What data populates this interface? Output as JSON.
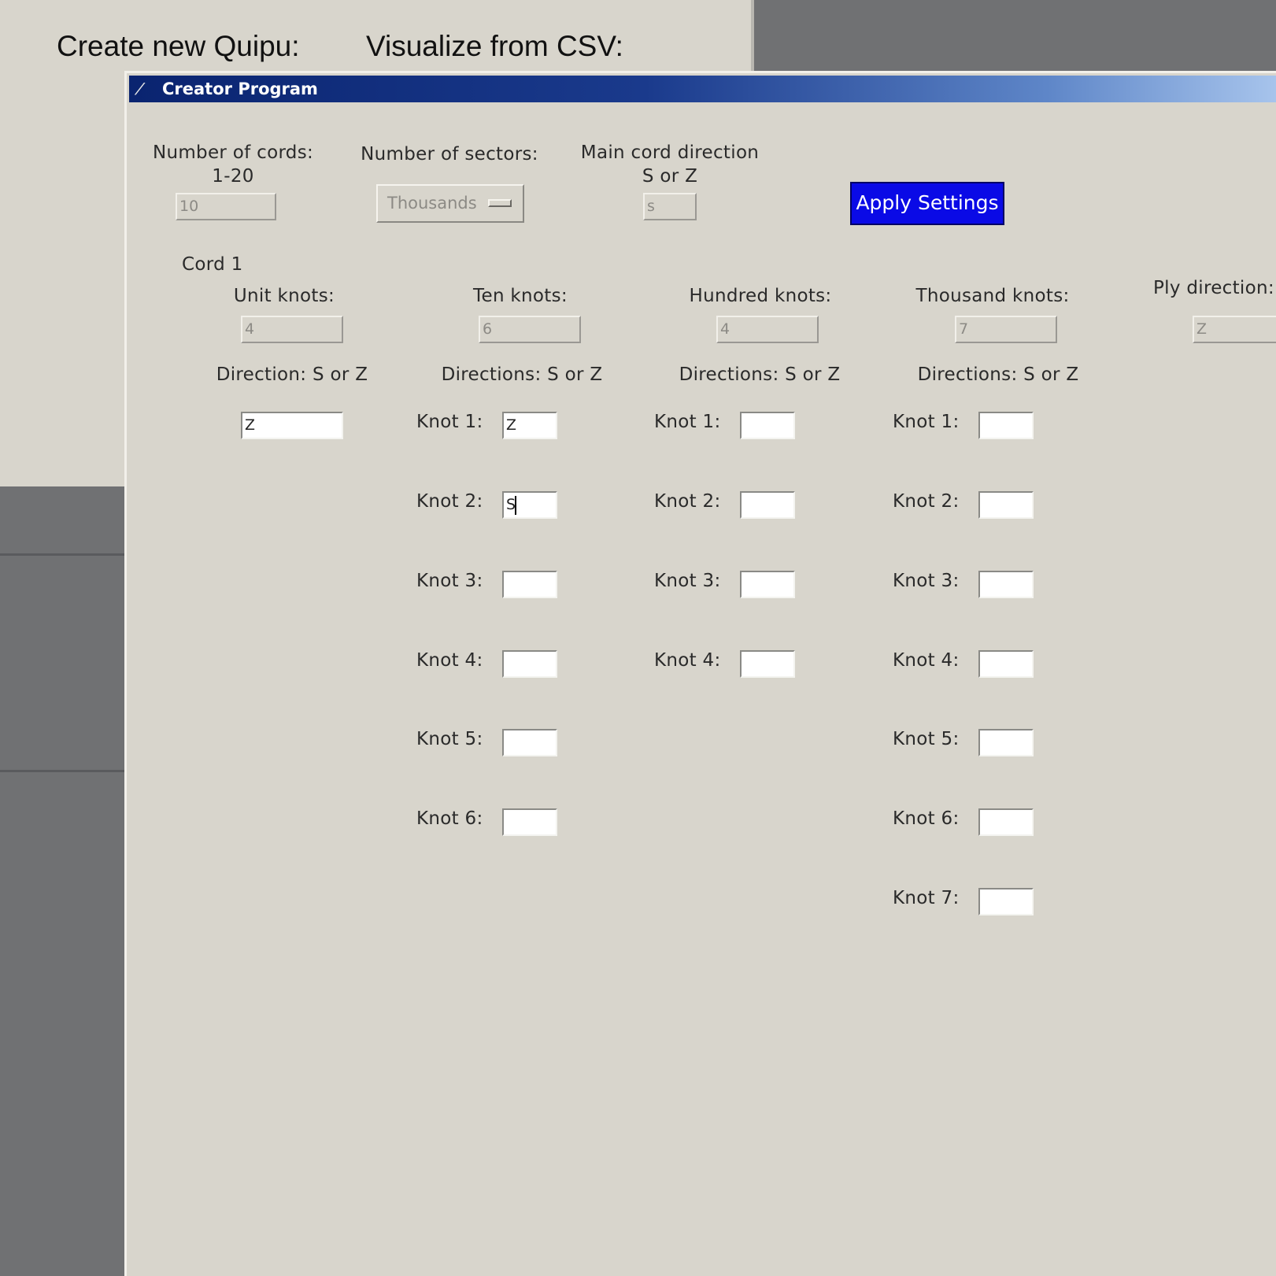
{
  "background_window": {
    "create_heading": "Create new Quipu:",
    "visualize_heading": "Visualize from CSV:"
  },
  "dialog": {
    "title": "Creator Program",
    "settings": {
      "cords_label_line1": "Number of cords:",
      "cords_label_line2": "1-20",
      "cords_value": "10",
      "sectors_label": "Number of sectors:",
      "sectors_selected": "Thousands",
      "direction_label_line1": "Main cord direction",
      "direction_label_line2": "S or Z",
      "direction_value": "s",
      "apply_label": "Apply Settings"
    },
    "cord": {
      "title": "Cord 1",
      "unit_knots_label": "Unit knots:",
      "unit_knots_value": "4",
      "ten_knots_label": "Ten knots:",
      "ten_knots_value": "6",
      "hundred_knots_label": "Hundred knots:",
      "hundred_knots_value": "4",
      "thousand_knots_label": "Thousand knots:",
      "thousand_knots_value": "7",
      "ply_label": "Ply direction:",
      "ply_value": "Z",
      "unit_direction_label": "Direction: S or Z",
      "unit_direction_value": "Z",
      "directions_label": "Directions: S or Z",
      "ten_knots": [
        {
          "label": "Knot 1:",
          "value": "Z"
        },
        {
          "label": "Knot 2:",
          "value": "S"
        },
        {
          "label": "Knot 3:",
          "value": ""
        },
        {
          "label": "Knot 4:",
          "value": ""
        },
        {
          "label": "Knot 5:",
          "value": ""
        },
        {
          "label": "Knot 6:",
          "value": ""
        }
      ],
      "hundred_knots": [
        {
          "label": "Knot 1:",
          "value": ""
        },
        {
          "label": "Knot 2:",
          "value": ""
        },
        {
          "label": "Knot 3:",
          "value": ""
        },
        {
          "label": "Knot 4:",
          "value": ""
        }
      ],
      "thousand_knots": [
        {
          "label": "Knot 1:",
          "value": ""
        },
        {
          "label": "Knot 2:",
          "value": ""
        },
        {
          "label": "Knot 3:",
          "value": ""
        },
        {
          "label": "Knot 4:",
          "value": ""
        },
        {
          "label": "Knot 5:",
          "value": ""
        },
        {
          "label": "Knot 6:",
          "value": ""
        },
        {
          "label": "Knot 7:",
          "value": ""
        }
      ]
    }
  }
}
